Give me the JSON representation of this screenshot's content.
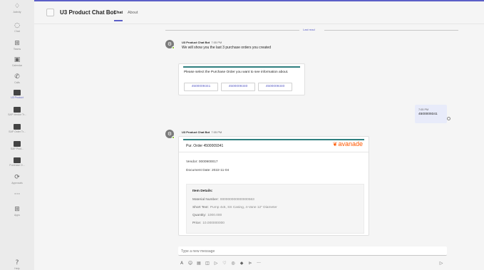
{
  "rail": {
    "items": [
      {
        "label": "Activity",
        "icon": "bell-icon",
        "glyph": "♢"
      },
      {
        "label": "Chat",
        "icon": "chat-icon",
        "glyph": "◌"
      },
      {
        "label": "Teams",
        "icon": "teams-icon",
        "glyph": "⊞"
      },
      {
        "label": "Calendar",
        "icon": "calendar-icon",
        "glyph": "▣"
      },
      {
        "label": "Calls",
        "icon": "phone-icon",
        "glyph": "✆"
      },
      {
        "label": "U3 Product",
        "icon": "app-square-icon",
        "glyph": ""
      },
      {
        "label": "SAP Vendor Tr...",
        "icon": "app-square-icon",
        "glyph": ""
      },
      {
        "label": "SAP Order Tr...",
        "icon": "app-square-icon",
        "glyph": ""
      },
      {
        "label": "SAP Prod...",
        "icon": "app-square-icon",
        "glyph": ""
      },
      {
        "label": "Purchase O...",
        "icon": "app-square-icon",
        "glyph": ""
      },
      {
        "label": "Approvals",
        "icon": "approvals-icon",
        "glyph": "⟳"
      },
      {
        "label": "",
        "icon": "more-icon",
        "glyph": "···"
      },
      {
        "label": "Apps",
        "icon": "apps-icon",
        "glyph": "⊞"
      }
    ],
    "help": {
      "label": "Help",
      "icon": "help-icon",
      "glyph": "?"
    }
  },
  "header": {
    "title": "U3 Product Chat Bot",
    "tabs": [
      "Chat",
      "About"
    ]
  },
  "divider": {
    "label": "Last read"
  },
  "bot_message_1": {
    "sender": "U3 Product Chat Bot",
    "time": "7:05 PM",
    "text": "We will show you the last 3 purchase orders you created",
    "card": {
      "prompt": "Please select the Purchase Order you want to see information about.",
      "buttons": [
        "4500009341",
        "4500009340",
        "4500009340"
      ]
    }
  },
  "user_message": {
    "time": "7:05 PM",
    "text": "4500009341"
  },
  "bot_message_2": {
    "sender": "U3 Product Chat Bot",
    "time": "7:05 PM",
    "card": {
      "title": "Pur. Order 4500009341",
      "brand": "avanade",
      "vendor": "Vendor: 0000900017",
      "document_date": "Document Date: 2022-11-04",
      "item_details_title": "Item Details:",
      "items": [
        {
          "label": "Material Number:",
          "value": "000000000000000563"
        },
        {
          "label": "Short Text:",
          "value": "Pump 4x5, SS Casing, 4-Vane 12\" Diameter"
        },
        {
          "label": "Quantity:",
          "value": "1000.000"
        },
        {
          "label": "Price:",
          "value": "10.000000000"
        }
      ]
    }
  },
  "composer": {
    "placeholder": "Type a new message",
    "tools": [
      {
        "icon": "format-icon",
        "glyph": "A"
      },
      {
        "icon": "emoji-icon",
        "glyph": "☺"
      },
      {
        "icon": "gif-icon",
        "glyph": "▤"
      },
      {
        "icon": "sticker-icon",
        "glyph": "◫"
      },
      {
        "icon": "meet-icon",
        "glyph": "▷"
      },
      {
        "icon": "praise-icon",
        "glyph": "♡"
      },
      {
        "icon": "loop-icon",
        "glyph": "◎"
      },
      {
        "icon": "attach-icon",
        "glyph": "◆"
      },
      {
        "icon": "approvals-icon",
        "glyph": "⊳"
      },
      {
        "icon": "more-icon",
        "glyph": "···"
      }
    ],
    "send_icon": "send-icon",
    "send_glyph": "▷"
  },
  "colors": {
    "accent": "#5b5fc7",
    "brand_orange": "#ff5800",
    "card_topline": "#2f7f7f",
    "my_bubble": "#e8ebfa"
  }
}
